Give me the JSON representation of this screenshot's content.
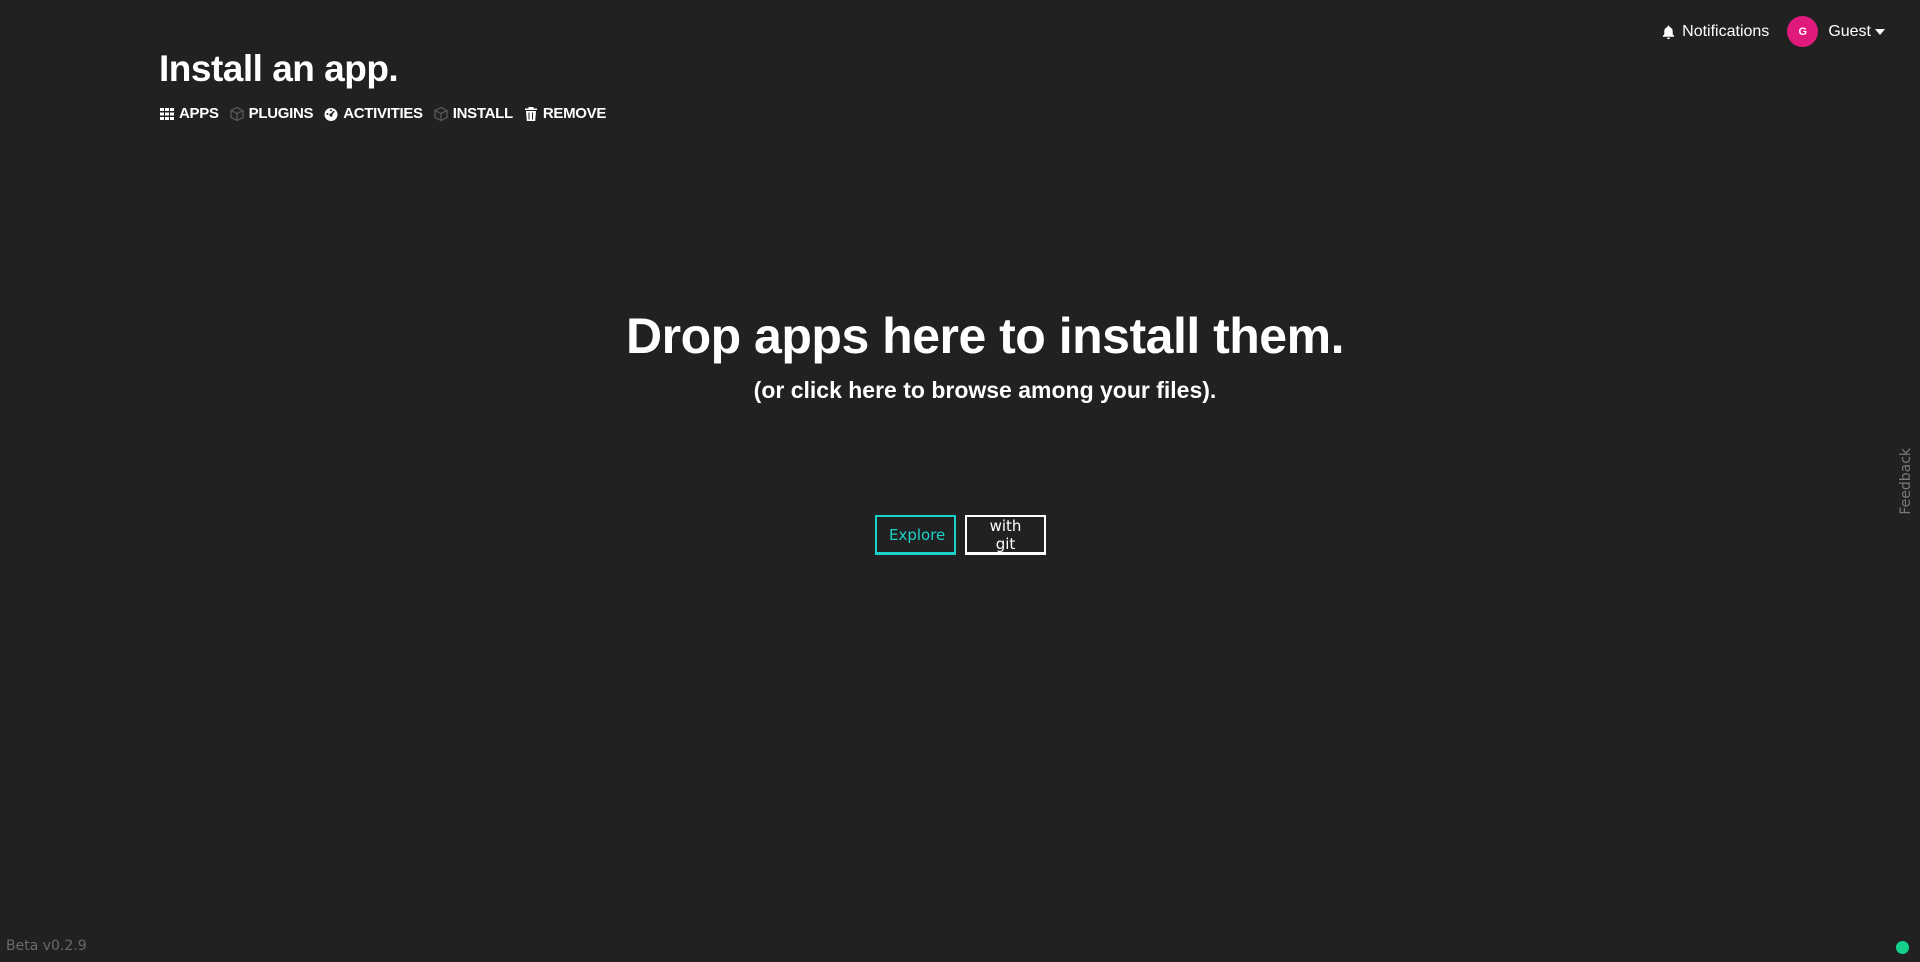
{
  "topbar": {
    "notifications_label": "Notifications",
    "notifications_icon": "bell-icon",
    "user_initial": "G",
    "user_name": "Guest",
    "avatar_color": "#e0197c"
  },
  "header": {
    "title": "Install an app."
  },
  "nav": {
    "items": [
      {
        "label": "APPS",
        "icon": "grid-icon"
      },
      {
        "label": "PLUGINS",
        "icon": "cube-icon"
      },
      {
        "label": "ACTIVITIES",
        "icon": "dashboard-icon"
      },
      {
        "label": "INSTALL",
        "icon": "cube-icon"
      },
      {
        "label": "REMOVE",
        "icon": "trash-icon"
      }
    ]
  },
  "dropzone": {
    "title": "Drop apps here to install them.",
    "subtitle": "(or click here to browse among your files)."
  },
  "actions": {
    "explore_label": "Explore",
    "git_label": "with git",
    "accent_color": "#1ad2c8"
  },
  "feedback_label": "Feedback",
  "footer": {
    "version": "Beta v0.2.9",
    "status_color": "#14d28c"
  }
}
